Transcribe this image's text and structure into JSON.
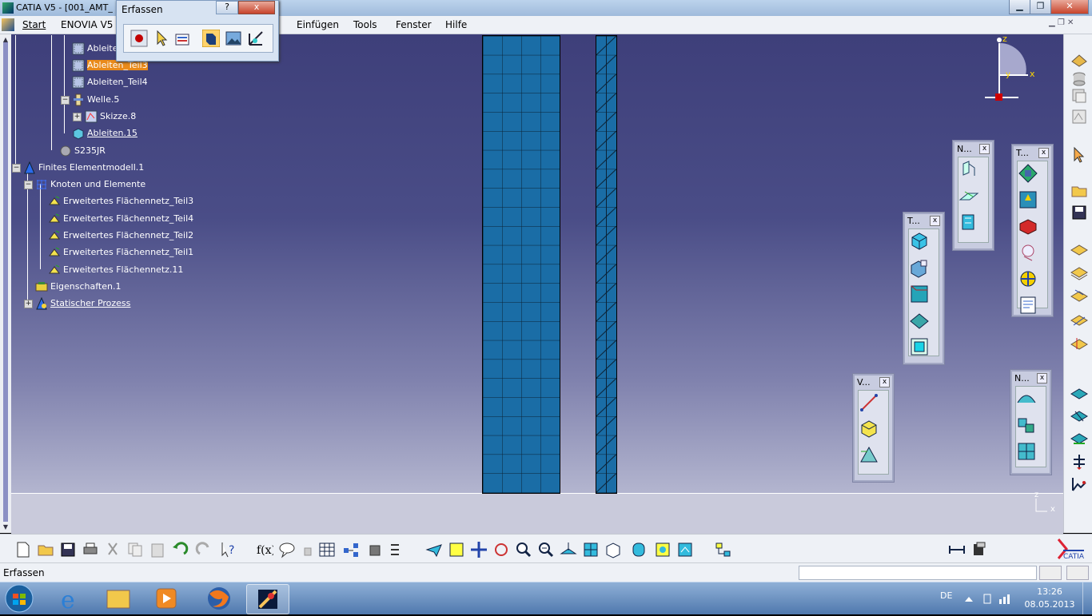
{
  "window": {
    "title": "CATIA V5 - [001_AMT_",
    "buttons": [
      "minimize",
      "restore",
      "close"
    ]
  },
  "menubar": {
    "items": [
      "Start",
      "ENOVIA V5 V",
      "Einfügen",
      "Tools",
      "Fenster",
      "Hilfe"
    ]
  },
  "erfassen_toolbar": {
    "title": "Erfassen",
    "help": "?",
    "close": "x"
  },
  "tree": {
    "nodes": [
      {
        "label": "Ableiten_",
        "icon": "derive-icon"
      },
      {
        "label": "Ableiten_Teil3",
        "icon": "derive-icon",
        "selected": true
      },
      {
        "label": "Ableiten_Teil4",
        "icon": "derive-icon"
      },
      {
        "label": "Welle.5",
        "icon": "shaft-icon"
      },
      {
        "label": "Skizze.8",
        "icon": "sketch-icon"
      },
      {
        "label": "Ableiten.15",
        "icon": "derive-icon",
        "underlined": true
      },
      {
        "label": "S235JR",
        "icon": "material-icon"
      },
      {
        "label": "Finites Elementmodell.1",
        "icon": "fem-model-icon"
      },
      {
        "label": "Knoten und Elemente",
        "icon": "nodes-elements-icon"
      },
      {
        "label": "Erweitertes Flächennetz_Teil3",
        "icon": "mesh-icon"
      },
      {
        "label": "Erweitertes Flächennetz_Teil4",
        "icon": "mesh-icon"
      },
      {
        "label": "Erweitertes Flächennetz_Teil2",
        "icon": "mesh-icon"
      },
      {
        "label": "Erweitertes Flächennetz_Teil1",
        "icon": "mesh-icon"
      },
      {
        "label": "Erweitertes Flächennetz.11",
        "icon": "mesh-icon"
      },
      {
        "label": "Eigenschaften.1",
        "icon": "properties-icon"
      },
      {
        "label": "Statischer Prozess",
        "icon": "static-process-icon",
        "underlined": true
      }
    ]
  },
  "compass": {
    "z": "z",
    "y": "y",
    "x": "x"
  },
  "axis_triad": {
    "z": "z",
    "x": "x"
  },
  "panels": [
    {
      "title": "T...",
      "close": "x"
    },
    {
      "title": "N...",
      "close": "x"
    },
    {
      "title": "T...",
      "close": "x"
    },
    {
      "title": "V...",
      "close": "x"
    },
    {
      "title": "N...",
      "close": "x"
    }
  ],
  "statusbar": {
    "text": "Erfassen",
    "input_value": ""
  },
  "taskbar": {
    "language": "DE",
    "time": "13:26",
    "date": "08.05.2013"
  },
  "colors": {
    "mesh": "#1a6da6",
    "selection": "#e98a1a",
    "viewport_top": "#3e3f7a"
  }
}
